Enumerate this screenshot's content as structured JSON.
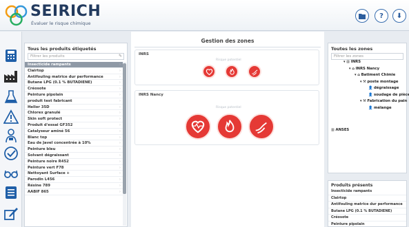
{
  "app": {
    "name": "SEIRICH",
    "tagline": "Évaluer le risque chimique",
    "colors": {
      "brand": "#223a5e",
      "accent": "#3a6fb0",
      "risk": "#e53935"
    }
  },
  "header_buttons": [
    {
      "icon": "folder-icon",
      "glyph": "▰"
    },
    {
      "icon": "help-icon",
      "glyph": "?"
    },
    {
      "icon": "download-icon",
      "glyph": "⬇"
    }
  ],
  "sidebar": [
    "calculator-icon",
    "factory-icon",
    "lab-icon",
    "warning-icon",
    "person-icon",
    "checkmark-icon",
    "glasses-icon",
    "list-icon",
    "edit-icon"
  ],
  "products": {
    "title": "Tous les produits étiquetés",
    "filter_placeholder": "Filtrer les produits",
    "items": [
      "Insecticide rampants",
      "Clairtop",
      "Antifouling matrice dur performance",
      "Butane LPG (0.1 % BUTADIENE)",
      "Créosote",
      "Peinture pipolain",
      "produit test fabricant",
      "Hellor 35D",
      "Chlorex granulé",
      "Skin soft protect",
      "Produit d'essai GF352",
      "Catalyseur aminé 56",
      "Blanc top",
      "Eau de Javel concentrée à 10%",
      "Peinture bleu",
      "Solvant dégraissant",
      "Peinture noire R452",
      "Peinture vert F78",
      "Nettoyant Surface +",
      "Parodin L456",
      "Résine 789",
      "AABIF 865"
    ]
  },
  "center": {
    "title": "Gestion des zones",
    "zones": [
      {
        "name": "INRS",
        "risk_label": "Risque potentiel",
        "risks": [
          "heart-risk-icon",
          "fire-risk-icon",
          "skin-risk-icon"
        ]
      },
      {
        "name": "INRS Nancy",
        "risk_label": "Risque potentiel",
        "risks": [
          "heart-risk-icon",
          "fire-risk-icon",
          "skin-risk-icon"
        ]
      }
    ]
  },
  "zones_panel": {
    "title": "Toutes les zones",
    "filter_placeholder": "Filtrer les zones",
    "tree": [
      {
        "label": "INRS",
        "level": 0
      },
      {
        "label": "INRS Nancy",
        "level": 1
      },
      {
        "label": "Batiment Chimie",
        "level": 2
      },
      {
        "label": "poste montage",
        "level": 3
      },
      {
        "label": "dégraissage",
        "level": 4
      },
      {
        "label": "soudage de pièces",
        "level": 4
      },
      {
        "label": "Fabrication du pain",
        "level": 3
      },
      {
        "label": "mélange",
        "level": 4
      },
      {
        "label": "ANSES",
        "level": 0
      }
    ]
  },
  "present_panel": {
    "title": "Produits présents",
    "items": [
      "Insecticide rampants",
      "Clairtop",
      "Antifouling matrice dur performance",
      "Butane LPG (0.1 % BUTADIENE)",
      "Créosote",
      "Peinture pipolain"
    ]
  }
}
